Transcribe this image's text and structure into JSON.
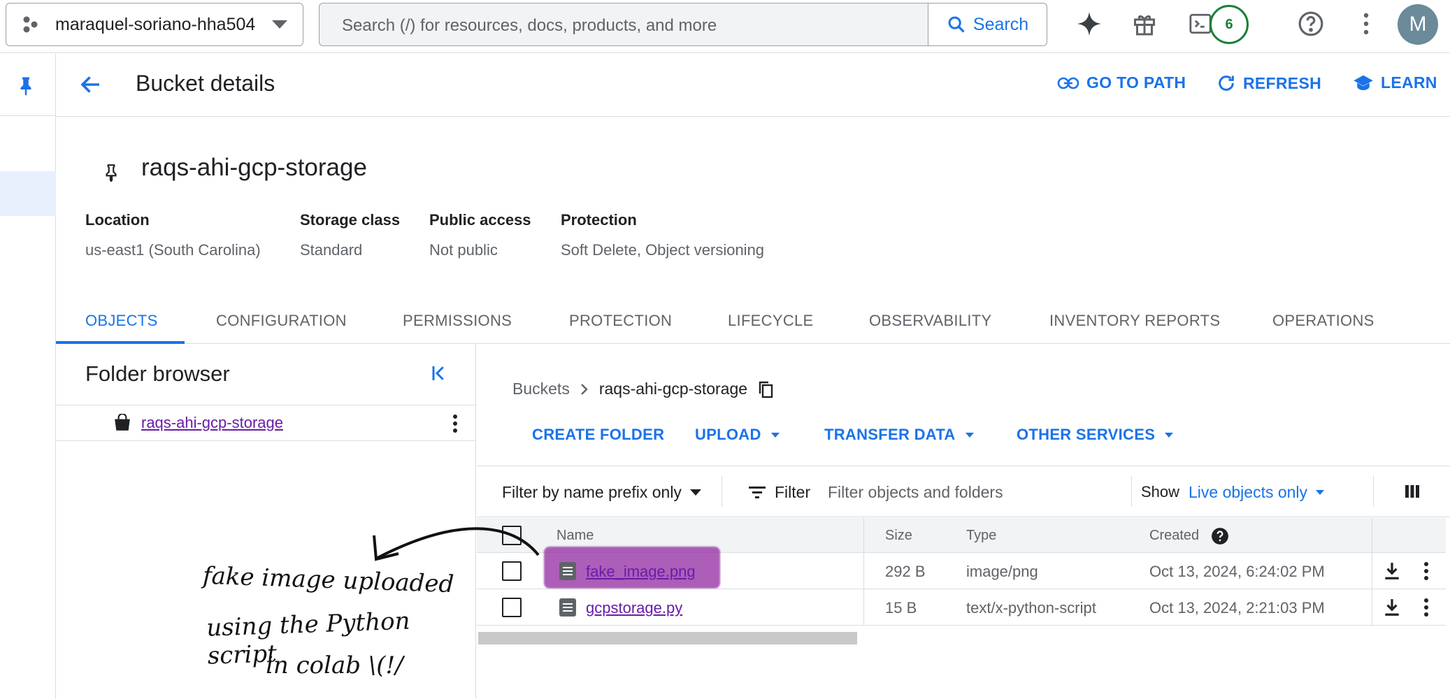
{
  "topbar": {
    "project": "maraquel-soriano-hha504",
    "search_placeholder": "Search (/) for resources, docs, products, and more",
    "search_button": "Search",
    "notification_count": "6",
    "avatar_letter": "M"
  },
  "header": {
    "title": "Bucket details",
    "go_to_path": "GO TO PATH",
    "refresh": "REFRESH",
    "learn": "LEARN"
  },
  "bucket": {
    "name": "raqs-ahi-gcp-storage",
    "meta": [
      {
        "label": "Location",
        "value": "us-east1 (South Carolina)"
      },
      {
        "label": "Storage class",
        "value": "Standard"
      },
      {
        "label": "Public access",
        "value": "Not public"
      },
      {
        "label": "Protection",
        "value": "Soft Delete, Object versioning"
      }
    ]
  },
  "tabs": [
    "OBJECTS",
    "CONFIGURATION",
    "PERMISSIONS",
    "PROTECTION",
    "LIFECYCLE",
    "OBSERVABILITY",
    "INVENTORY REPORTS",
    "OPERATIONS"
  ],
  "folder_browser": {
    "title": "Folder browser",
    "bucket": "raqs-ahi-gcp-storage"
  },
  "breadcrumb": {
    "root": "Buckets",
    "current": "raqs-ahi-gcp-storage"
  },
  "actions": {
    "create_folder": "CREATE FOLDER",
    "upload": "UPLOAD",
    "transfer_data": "TRANSFER DATA",
    "other_services": "OTHER SERVICES"
  },
  "filter": {
    "prefix": "Filter by name prefix only",
    "filter_label": "Filter",
    "placeholder": "Filter objects and folders",
    "show_label": "Show",
    "show_value": "Live objects only"
  },
  "table": {
    "headers": {
      "name": "Name",
      "size": "Size",
      "type": "Type",
      "created": "Created"
    },
    "rows": [
      {
        "name": "fake_image.png",
        "size": "292 B",
        "type": "image/png",
        "created": "Oct 13, 2024, 6:24:02 PM"
      },
      {
        "name": "gcpstorage.py",
        "size": "15 B",
        "type": "text/x-python-script",
        "created": "Oct 13, 2024, 2:21:03 PM"
      }
    ]
  },
  "annotation": {
    "line1": "fake image uploaded",
    "line2": "using the Python script",
    "line3": "in colab \\(!/"
  },
  "colors": {
    "accent": "#1a73e8",
    "visited_link": "#681da8",
    "highlight": "#9128a0"
  }
}
